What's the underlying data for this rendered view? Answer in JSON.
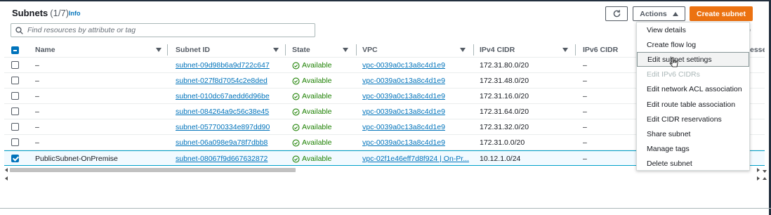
{
  "header": {
    "title": "Subnets",
    "count": "(1/7)",
    "info": "Info"
  },
  "buttons": {
    "refresh_icon": "refresh-icon",
    "actions": "Actions",
    "create": "Create subnet"
  },
  "search": {
    "placeholder": "Find resources by attribute or tag"
  },
  "columns": [
    "Name",
    "Subnet ID",
    "State",
    "VPC",
    "IPv4 CIDR",
    "IPv6 CIDR"
  ],
  "partial_column": "esses",
  "rows": [
    {
      "name": "–",
      "subnet_id": "subnet-09d98b6a9d722c647",
      "state": "Available",
      "vpc": "vpc-0039a0c13a8c4d1e9",
      "ipv4": "172.31.80.0/20",
      "ipv6": "–",
      "selected": false
    },
    {
      "name": "–",
      "subnet_id": "subnet-027f8d7054c2e8ded",
      "state": "Available",
      "vpc": "vpc-0039a0c13a8c4d1e9",
      "ipv4": "172.31.48.0/20",
      "ipv6": "–",
      "selected": false
    },
    {
      "name": "–",
      "subnet_id": "subnet-010dc67aedd6d96be",
      "state": "Available",
      "vpc": "vpc-0039a0c13a8c4d1e9",
      "ipv4": "172.31.16.0/20",
      "ipv6": "–",
      "selected": false
    },
    {
      "name": "–",
      "subnet_id": "subnet-084264a9c56c38e45",
      "state": "Available",
      "vpc": "vpc-0039a0c13a8c4d1e9",
      "ipv4": "172.31.64.0/20",
      "ipv6": "–",
      "selected": false
    },
    {
      "name": "–",
      "subnet_id": "subnet-057700334e897dd90",
      "state": "Available",
      "vpc": "vpc-0039a0c13a8c4d1e9",
      "ipv4": "172.31.32.0/20",
      "ipv6": "–",
      "selected": false
    },
    {
      "name": "–",
      "subnet_id": "subnet-06a098e9a78f7dbb8",
      "state": "Available",
      "vpc": "vpc-0039a0c13a8c4d1e9",
      "ipv4": "172.31.0.0/20",
      "ipv6": "–",
      "selected": false
    },
    {
      "name": "PublicSubnet-OnPremise",
      "subnet_id": "subnet-08067f9d667632872",
      "state": "Available",
      "vpc": "vpc-02f1e46eff7d8f924 | On-Pr...",
      "ipv4": "10.12.1.0/24",
      "ipv6": "–",
      "selected": true
    }
  ],
  "menu": {
    "items": [
      {
        "label": "View details",
        "disabled": false
      },
      {
        "label": "Create flow log",
        "disabled": false
      },
      {
        "label": "Edit subnet settings",
        "disabled": false,
        "hover": true
      },
      {
        "label": "Edit IPv6 CIDRs",
        "disabled": true
      },
      {
        "label": "Edit network ACL association",
        "disabled": false
      },
      {
        "label": "Edit route table association",
        "disabled": false
      },
      {
        "label": "Edit CIDR reservations",
        "disabled": false
      },
      {
        "label": "Share subnet",
        "disabled": false
      },
      {
        "label": "Manage tags",
        "disabled": false
      },
      {
        "label": "Delete subnet",
        "disabled": false
      }
    ]
  },
  "colors": {
    "accent": "#0073bb",
    "primary_button": "#ec7211",
    "status_ok": "#1d8102"
  }
}
